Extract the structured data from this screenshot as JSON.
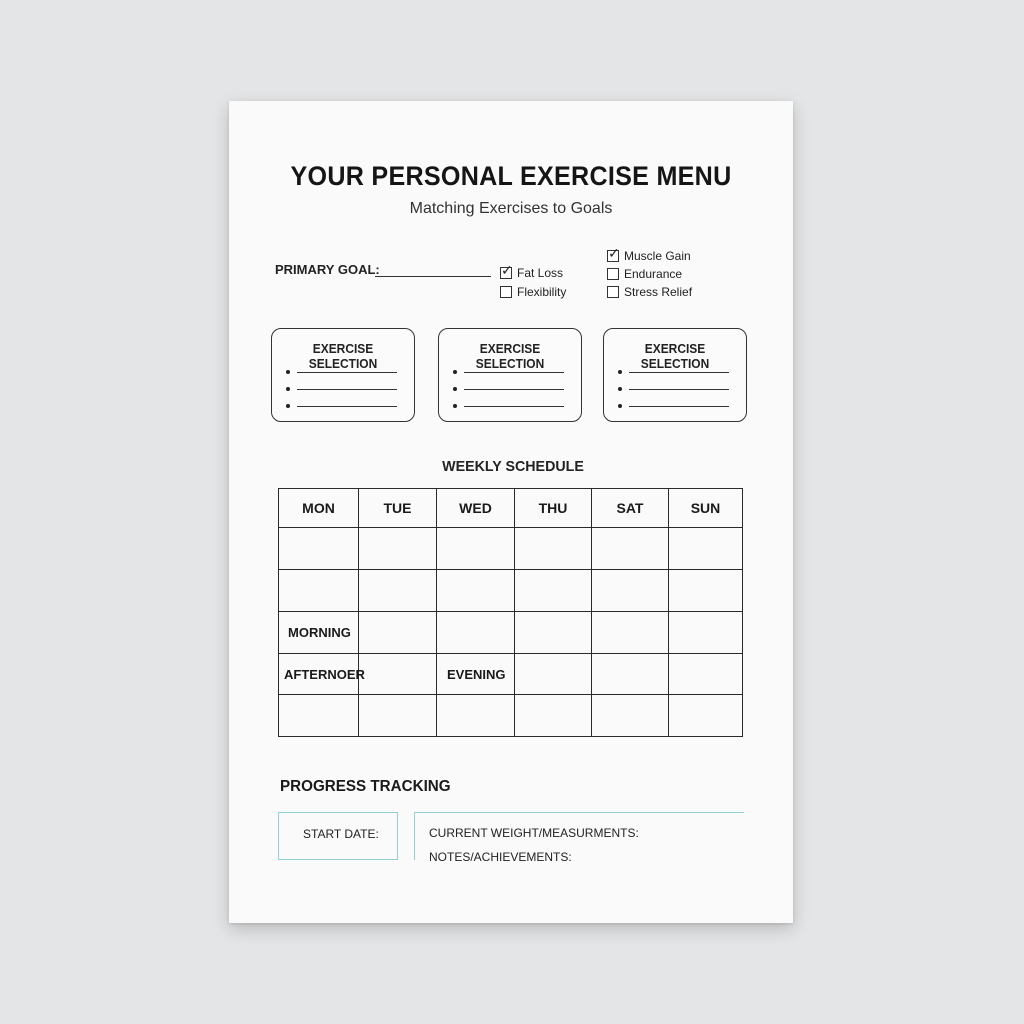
{
  "header": {
    "title": "YOUR PERSONAL EXERCISE MENU",
    "subtitle": "Matching Exercises to Goals"
  },
  "primary_goal": {
    "label": "PRIMARY GOAL:",
    "options": [
      {
        "label": "Fat Loss",
        "checked": true
      },
      {
        "label": "Flexibility",
        "checked": false
      },
      {
        "label": "Muscle Gain",
        "checked": true
      },
      {
        "label": "Endurance",
        "checked": false
      },
      {
        "label": "Stress Relief",
        "checked": false
      }
    ]
  },
  "exercise_cards": [
    {
      "title": "EXERCISE SELECTION"
    },
    {
      "title": "EXERCISE SELECTION"
    },
    {
      "title": "EXERCISE SELECTION"
    }
  ],
  "schedule": {
    "title": "WEEKLY SCHEDULE",
    "days": [
      "MON",
      "TUE",
      "WED",
      "THU",
      "SAT",
      "SUN"
    ],
    "labels": {
      "morning": "MORNING",
      "afternoon": "AFTERNOER",
      "evening": "EVENING"
    }
  },
  "progress": {
    "title": "PROGRESS TRACKING",
    "start_date": "START DATE:",
    "current_weight": "CURRENT WEIGHT/MEASURMENTS:",
    "notes": "NOTES/ACHIEVEMENTS:"
  },
  "colors": {
    "background": "#e4e5e6",
    "paper": "#fafafa",
    "accent_teal": "#8ed2d6"
  }
}
